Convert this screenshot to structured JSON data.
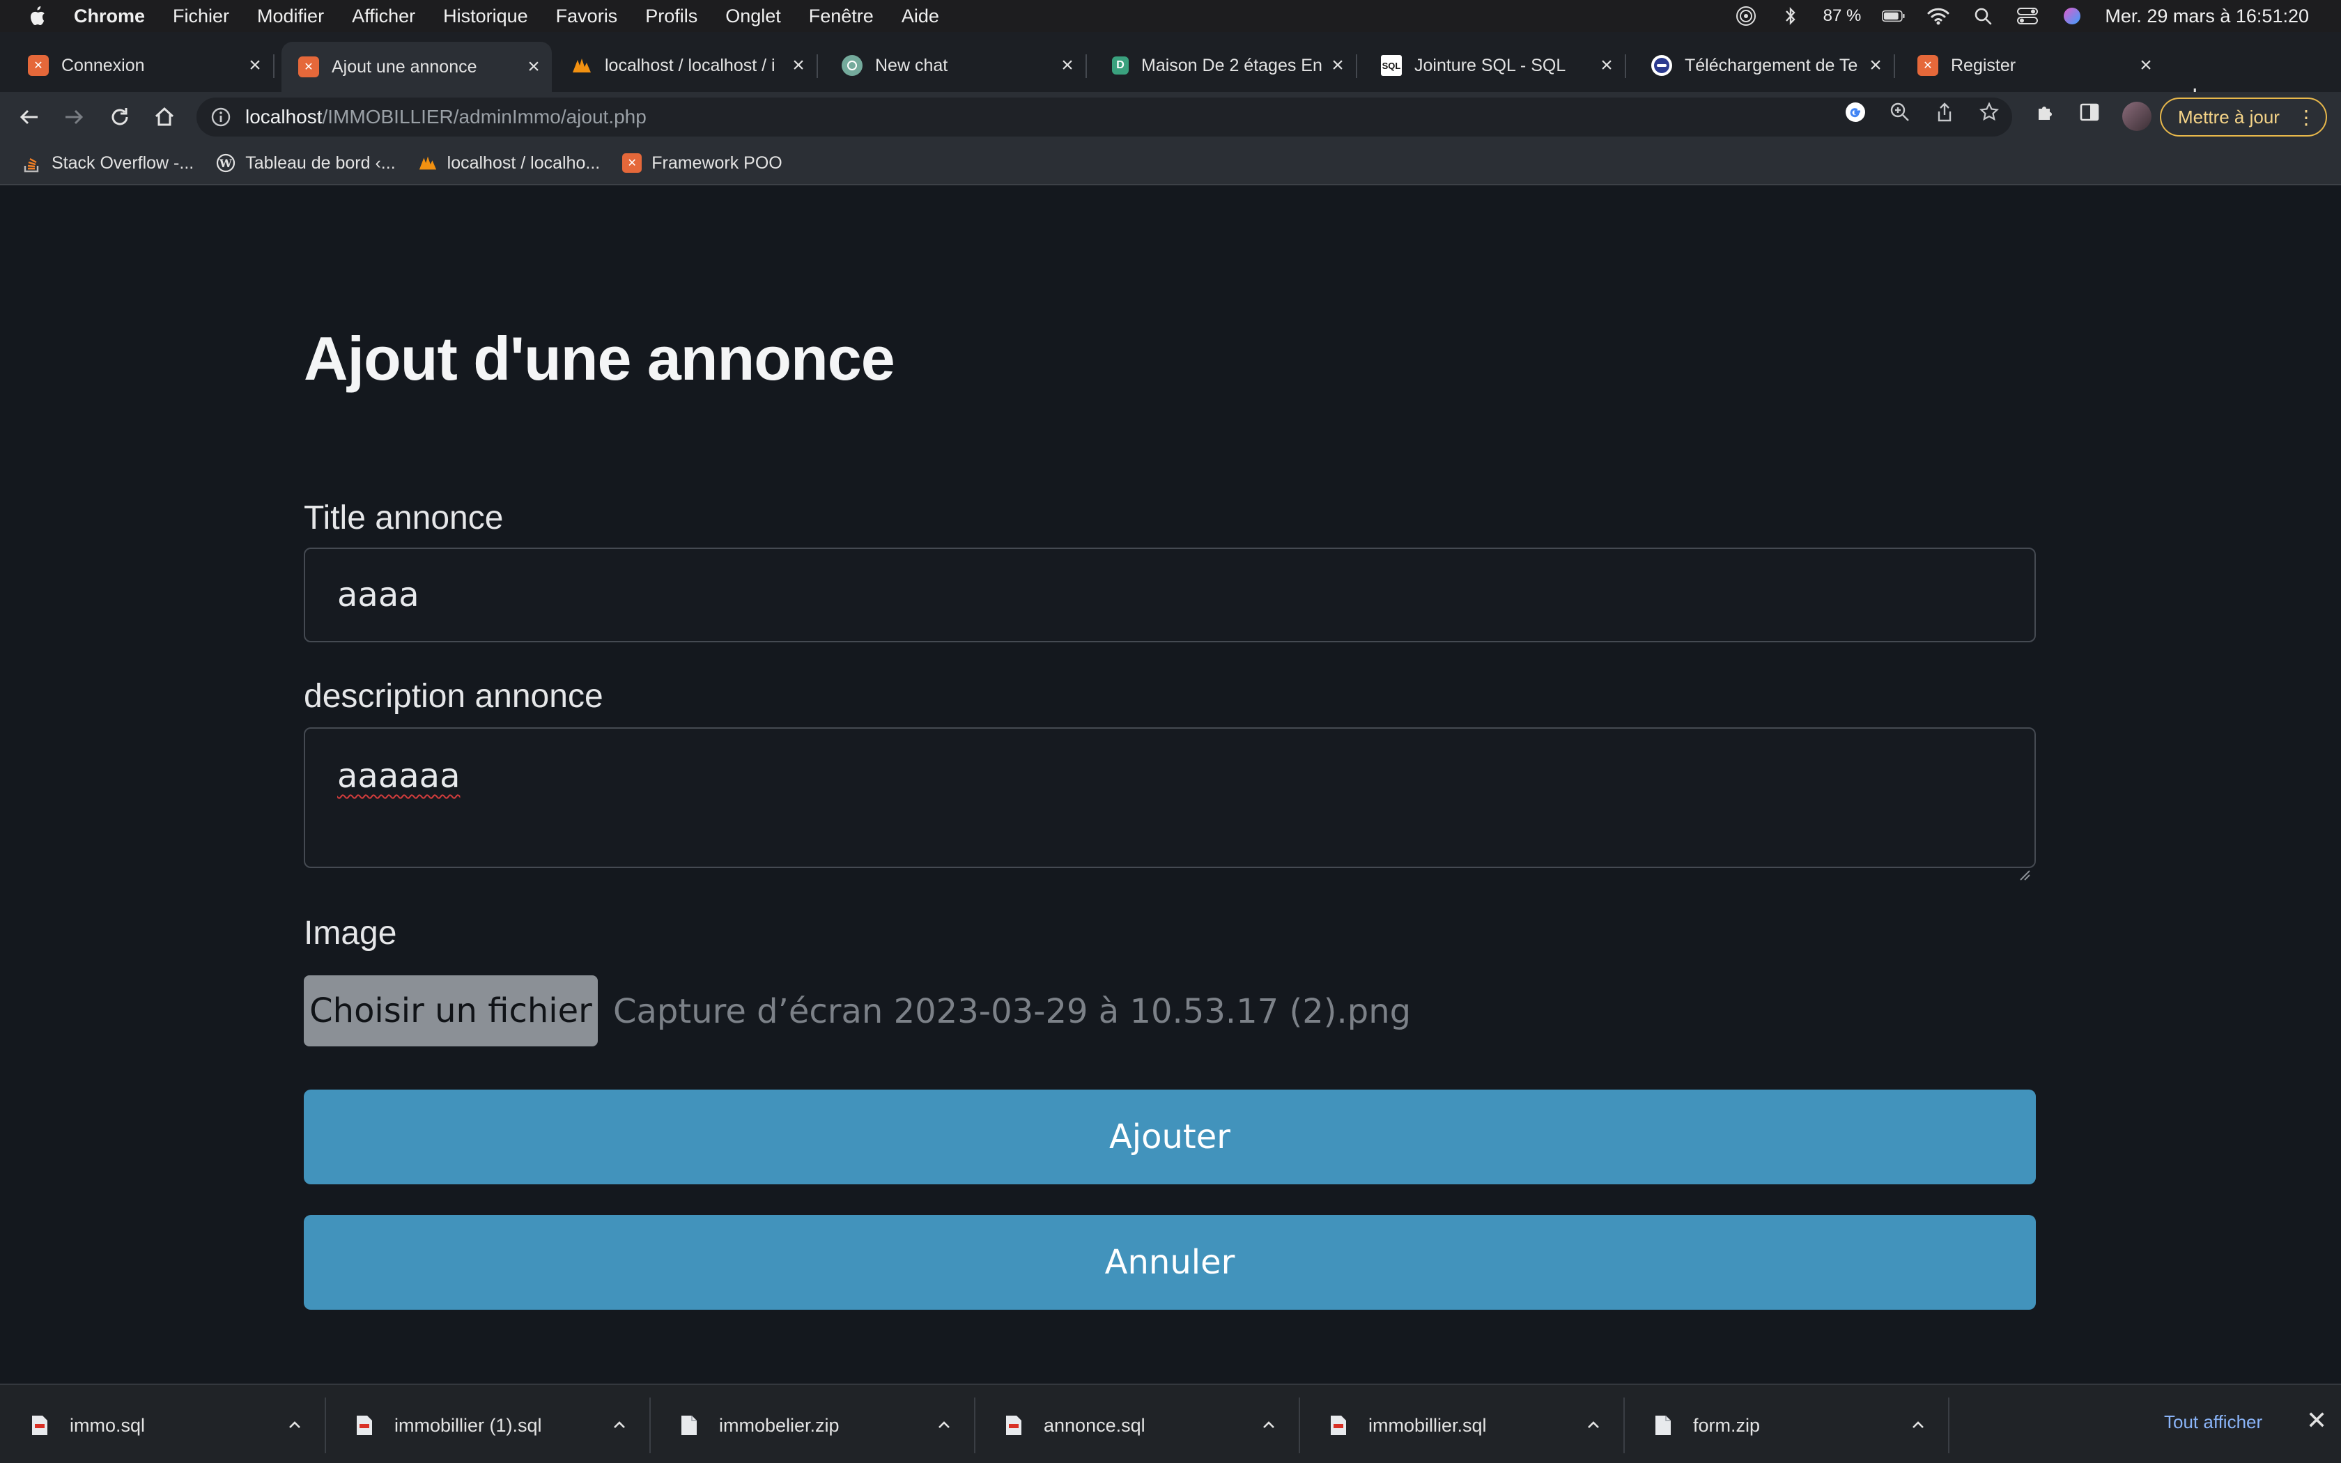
{
  "menubar": {
    "app": "Chrome",
    "items": [
      "Fichier",
      "Modifier",
      "Afficher",
      "Historique",
      "Favoris",
      "Profils",
      "Onglet",
      "Fenêtre",
      "Aide"
    ],
    "battery": "87 %",
    "datetime": "Mer. 29 mars à 16:51:20"
  },
  "tabs": [
    {
      "title": "Connexion",
      "icon": "xampp-icon",
      "color": "#e5683a"
    },
    {
      "title": "Ajout une annonce",
      "icon": "xampp-icon",
      "color": "#e5683a",
      "active": true
    },
    {
      "title": "localhost / localhost / i",
      "icon": "phpmyadmin-icon",
      "color": "#f29111"
    },
    {
      "title": "New chat",
      "icon": "chatgpt-icon",
      "color": "#74aa9c"
    },
    {
      "title": "Maison De 2 étages En",
      "icon": "site-icon",
      "color": "#3aa17e"
    },
    {
      "title": "Jointure SQL - SQL",
      "icon": "sql-icon",
      "color": "#ffffff"
    },
    {
      "title": "Téléchargement de Te",
      "icon": "teams-icon",
      "color": "#4a5fc1"
    },
    {
      "title": "Register",
      "icon": "xampp-icon",
      "color": "#e5683a"
    }
  ],
  "address": {
    "host": "localhost",
    "path": "/IMMOBILLIER/adminImmo/ajout.php"
  },
  "update_button": "Mettre à jour",
  "bookmarks": [
    {
      "label": "Stack Overflow -...",
      "icon": "stackoverflow-icon"
    },
    {
      "label": "Tableau de bord ‹...",
      "icon": "wordpress-icon"
    },
    {
      "label": "localhost / localho...",
      "icon": "phpmyadmin-icon"
    },
    {
      "label": "Framework POO",
      "icon": "xampp-icon"
    }
  ],
  "form": {
    "heading": "Ajout d'une annonce",
    "title_label": "Title annonce",
    "title_value": "aaaa",
    "description_label": "description annonce",
    "description_value": "aaaaaa",
    "image_label": "Image",
    "file_button": "Choisir un fichier",
    "file_name": "Capture d’écran 2023-03-29 à 10.53.17 (2).png",
    "submit": "Ajouter",
    "cancel": "Annuler"
  },
  "downloads": {
    "items": [
      "immo.sql",
      "immobillier (1).sql",
      "immobelier.zip",
      "annonce.sql",
      "immobillier.sql",
      "form.zip"
    ],
    "show_all": "Tout afficher"
  },
  "colors": {
    "accent": "#4293bc",
    "background": "#14181e",
    "update": "#e8b84b"
  }
}
